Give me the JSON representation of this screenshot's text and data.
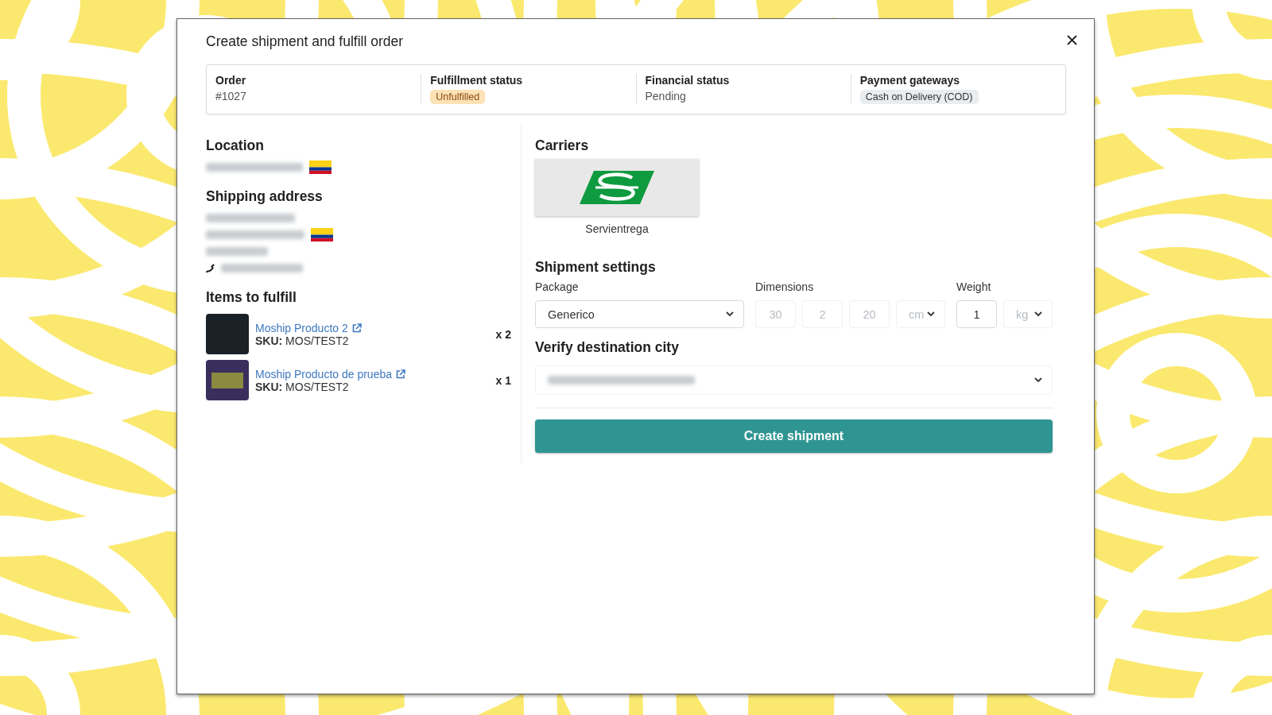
{
  "dialog": {
    "title": "Create shipment and fulfill order"
  },
  "summary": [
    {
      "label": "Order",
      "value": "#1027",
      "kind": "text"
    },
    {
      "label": "Fulfillment status",
      "value": "Unfulfilled",
      "kind": "badge",
      "color": "#fde2b5"
    },
    {
      "label": "Financial status",
      "value": "Pending",
      "kind": "text"
    },
    {
      "label": "Payment gateways",
      "value": "Cash on Delivery (COD)",
      "kind": "badge",
      "color": "#e9edf0"
    }
  ],
  "location": {
    "heading": "Location"
  },
  "shipping_address": {
    "heading": "Shipping address"
  },
  "items": {
    "heading": "Items to fulfill",
    "list": [
      {
        "name": "Moship Producto 2",
        "sku_label": "SKU:",
        "sku": "MOS/TEST2",
        "quantity": "x 2",
        "kind": "dark"
      },
      {
        "name": "Moship Producto de prueba",
        "sku_label": "SKU:",
        "sku": "MOS/TEST2",
        "quantity": "x 1",
        "kind": "photo"
      }
    ]
  },
  "carriers": {
    "heading": "Carriers",
    "list": [
      {
        "name": "Servientrega"
      }
    ]
  },
  "shipment_settings": {
    "heading": "Shipment settings",
    "package": {
      "label": "Package",
      "value": "Generico"
    },
    "dimensions": {
      "label": "Dimensions",
      "fields": [
        {
          "value": "30",
          "disabled": true
        },
        {
          "value": "2",
          "disabled": true
        },
        {
          "value": "20",
          "disabled": true
        }
      ],
      "unit": {
        "value": "cm",
        "disabled": true
      }
    },
    "weight": {
      "label": "Weight",
      "value": "1",
      "disabled": false,
      "unit": {
        "value": "kg",
        "disabled": true
      }
    }
  },
  "destination": {
    "heading": "Verify destination city"
  },
  "submit": "Create shipment"
}
